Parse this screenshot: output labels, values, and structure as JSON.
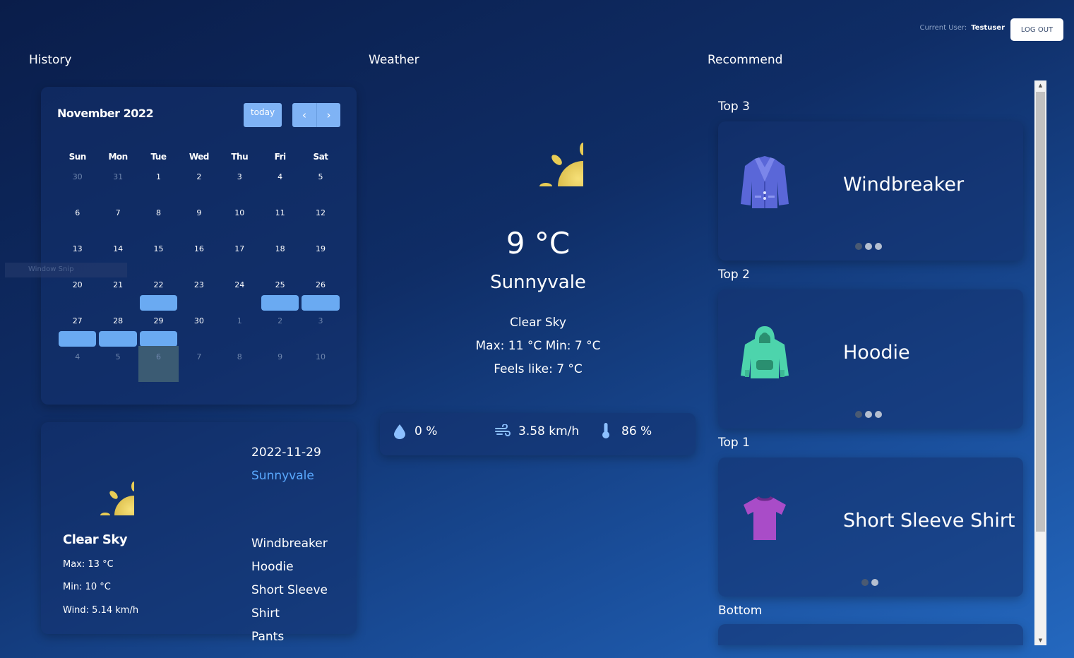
{
  "header": {
    "current_user_label": "Current User:",
    "username": "Testuser",
    "logout_label": "LOG OUT"
  },
  "sections": {
    "history": "History",
    "weather": "Weather",
    "recommend": "Recommend"
  },
  "calendar": {
    "title": "November 2022",
    "today_label": "today",
    "prev_icon": "‹",
    "next_icon": "›",
    "weekdays": [
      "Sun",
      "Mon",
      "Tue",
      "Wed",
      "Thu",
      "Fri",
      "Sat"
    ],
    "weeks": [
      [
        [
          "30",
          true
        ],
        [
          "31",
          true
        ],
        [
          "1",
          false
        ],
        [
          "2",
          false
        ],
        [
          "3",
          false
        ],
        [
          "4",
          false
        ],
        [
          "5",
          false
        ]
      ],
      [
        [
          "6",
          false
        ],
        [
          "7",
          false
        ],
        [
          "8",
          false
        ],
        [
          "9",
          false
        ],
        [
          "10",
          false
        ],
        [
          "11",
          false
        ],
        [
          "12",
          false
        ]
      ],
      [
        [
          "13",
          false
        ],
        [
          "14",
          false
        ],
        [
          "15",
          false
        ],
        [
          "16",
          false
        ],
        [
          "17",
          false
        ],
        [
          "18",
          false
        ],
        [
          "19",
          false
        ]
      ],
      [
        [
          "20",
          false
        ],
        [
          "21",
          false
        ],
        [
          "22",
          false
        ],
        [
          "23",
          false
        ],
        [
          "24",
          false
        ],
        [
          "25",
          false
        ],
        [
          "26",
          false
        ]
      ],
      [
        [
          "27",
          false
        ],
        [
          "28",
          false
        ],
        [
          "29",
          false
        ],
        [
          "30",
          false
        ],
        [
          "1",
          true
        ],
        [
          "2",
          true
        ],
        [
          "3",
          true
        ]
      ],
      [
        [
          "4",
          true
        ],
        [
          "5",
          true
        ],
        [
          "6",
          true
        ],
        [
          "7",
          true
        ],
        [
          "8",
          true
        ],
        [
          "9",
          true
        ],
        [
          "10",
          true
        ]
      ]
    ],
    "event_days": [
      "22",
      "25",
      "26",
      "27",
      "28",
      "29"
    ],
    "highlight_day": "6"
  },
  "snip_label": "Window Snip",
  "history_detail": {
    "condition": "Clear Sky",
    "max": "Max: 13 °C",
    "min": "Min: 10 °C",
    "wind": "Wind: 5.14 km/h",
    "date": "2022-11-29",
    "city": "Sunnyvale",
    "items": [
      "Windbreaker",
      "Hoodie",
      "Short Sleeve Shirt",
      "Pants"
    ]
  },
  "weather": {
    "icon": "sun-icon",
    "temp": "9 °C",
    "city": "Sunnyvale",
    "condition": "Clear Sky",
    "maxmin": "Max: 11 °C Min: 7 °C",
    "feels": "Feels like: 7 °C",
    "precip": "0 %",
    "wind": "3.58 km/h",
    "humidity": "86 %"
  },
  "recommend": [
    {
      "label": "Top 3",
      "name": "Windbreaker",
      "icon": "jacket-icon",
      "dots": 3,
      "active": 1
    },
    {
      "label": "Top 2",
      "name": "Hoodie",
      "icon": "hoodie-icon",
      "dots": 3,
      "active": 1
    },
    {
      "label": "Top 1",
      "name": "Short Sleeve Shirt",
      "icon": "tshirt-icon",
      "dots": 2,
      "active": 1
    },
    {
      "label": "Bottom"
    }
  ],
  "colors": {
    "accent": "#7fb3f5",
    "event": "#6aaaf2",
    "link": "#5aa9ff",
    "sun": "#e2c44a"
  }
}
